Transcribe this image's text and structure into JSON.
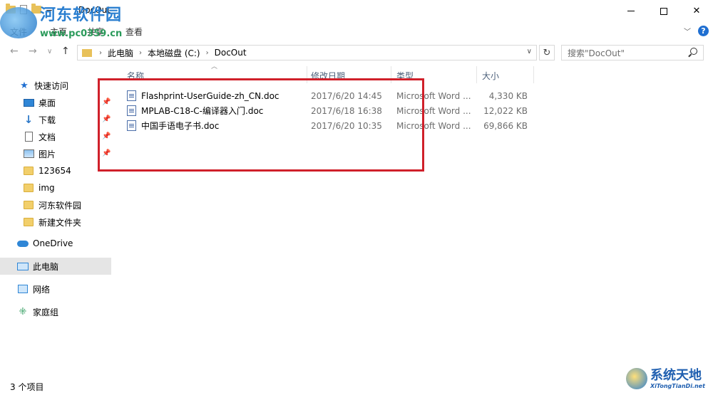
{
  "window": {
    "title": "DocOut",
    "quick_access_sep": "="
  },
  "ribbon": {
    "tabs": [
      "文件",
      "主页",
      "共享",
      "查看"
    ]
  },
  "address": {
    "crumbs": [
      "此电脑",
      "本地磁盘 (C:)",
      "DocOut"
    ],
    "search_placeholder": "搜索\"DocOut\""
  },
  "nav": {
    "quick_access": "快速访问",
    "items": [
      "桌面",
      "下载",
      "文档",
      "图片",
      "123654",
      "img",
      "河东软件园",
      "新建文件夹"
    ],
    "onedrive": "OneDrive",
    "this_pc": "此电脑",
    "network": "网络",
    "homegroup": "家庭组"
  },
  "columns": {
    "name": "名称",
    "date": "修改日期",
    "type": "类型",
    "size": "大小"
  },
  "files": [
    {
      "name": "Flashprint-UserGuide-zh_CN.doc",
      "date": "2017/6/20 14:45",
      "type": "Microsoft Word ...",
      "size": "4,330 KB"
    },
    {
      "name": "MPLAB-C18-C-编译器入门.doc",
      "date": "2017/6/18 16:38",
      "type": "Microsoft Word ...",
      "size": "12,022 KB"
    },
    {
      "name": "中国手语电子书.doc",
      "date": "2017/6/20 10:35",
      "type": "Microsoft Word ...",
      "size": "69,866 KB"
    }
  ],
  "status": {
    "count": "3 个项目"
  },
  "watermarks": {
    "top_name": "河东软件园",
    "top_url": "www.pc0359.cn",
    "br_name": "系统天地",
    "br_url": "XiTongTianDi.net"
  },
  "colors": {
    "highlight": "#d0202a",
    "accent": "#1f6fd1"
  }
}
